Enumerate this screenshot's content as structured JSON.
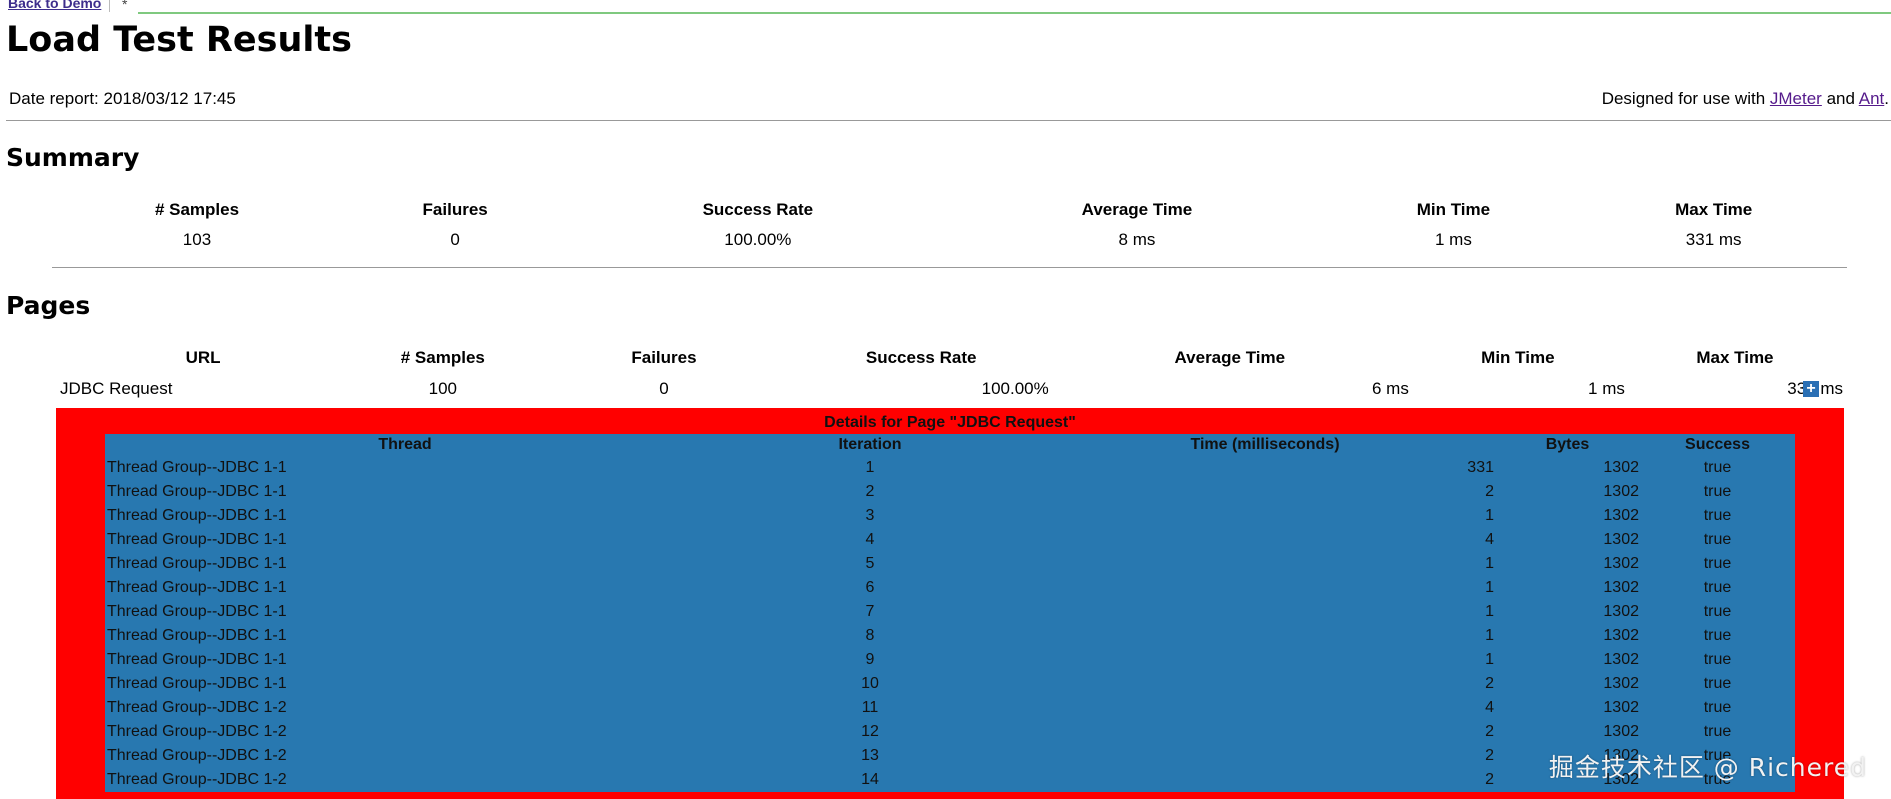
{
  "topbar": {
    "back_link": "Back to Demo",
    "tab_marker": "*"
  },
  "page_title": "Load Test Results",
  "date_report": "Date report: 2018/03/12 17:45",
  "designed": {
    "prefix": "Designed for use with ",
    "jmeter": "JMeter",
    "and": " and ",
    "ant": "Ant",
    "suffix": "."
  },
  "summary": {
    "title": "Summary",
    "headers": [
      "# Samples",
      "Failures",
      "Success Rate",
      "Average Time",
      "Min Time",
      "Max Time"
    ],
    "values": [
      "103",
      "0",
      "100.00%",
      "8 ms",
      "1 ms",
      "331 ms"
    ]
  },
  "pages": {
    "title": "Pages",
    "headers": [
      "URL",
      "# Samples",
      "Failures",
      "Success Rate",
      "Average Time",
      "Min Time",
      "Max Time"
    ],
    "row": [
      "JDBC Request",
      "100",
      "0",
      "100.00%",
      "6 ms",
      "1 ms",
      "331 ms"
    ],
    "expand_symbol": "+"
  },
  "details": {
    "caption": "Details for Page \"JDBC Request\"",
    "headers": [
      "Thread",
      "Iteration",
      "Time (milliseconds)",
      "Bytes",
      "Success"
    ],
    "rows": [
      [
        "Thread Group--JDBC 1-1",
        "1",
        "331",
        "1302",
        "true"
      ],
      [
        "Thread Group--JDBC 1-1",
        "2",
        "2",
        "1302",
        "true"
      ],
      [
        "Thread Group--JDBC 1-1",
        "3",
        "1",
        "1302",
        "true"
      ],
      [
        "Thread Group--JDBC 1-1",
        "4",
        "4",
        "1302",
        "true"
      ],
      [
        "Thread Group--JDBC 1-1",
        "5",
        "1",
        "1302",
        "true"
      ],
      [
        "Thread Group--JDBC 1-1",
        "6",
        "1",
        "1302",
        "true"
      ],
      [
        "Thread Group--JDBC 1-1",
        "7",
        "1",
        "1302",
        "true"
      ],
      [
        "Thread Group--JDBC 1-1",
        "8",
        "1",
        "1302",
        "true"
      ],
      [
        "Thread Group--JDBC 1-1",
        "9",
        "1",
        "1302",
        "true"
      ],
      [
        "Thread Group--JDBC 1-1",
        "10",
        "2",
        "1302",
        "true"
      ],
      [
        "Thread Group--JDBC 1-2",
        "11",
        "4",
        "1302",
        "true"
      ],
      [
        "Thread Group--JDBC 1-2",
        "12",
        "2",
        "1302",
        "true"
      ],
      [
        "Thread Group--JDBC 1-2",
        "13",
        "2",
        "1302",
        "true"
      ],
      [
        "Thread Group--JDBC 1-2",
        "14",
        "2",
        "1302",
        "true"
      ]
    ]
  },
  "watermark": "掘金技术社区 @ Richered",
  "colors": {
    "details_bg": "#ff0000",
    "details_table_bg": "#2878b0",
    "link": "#551a8b",
    "expand_icon": "#2a6fb4"
  }
}
